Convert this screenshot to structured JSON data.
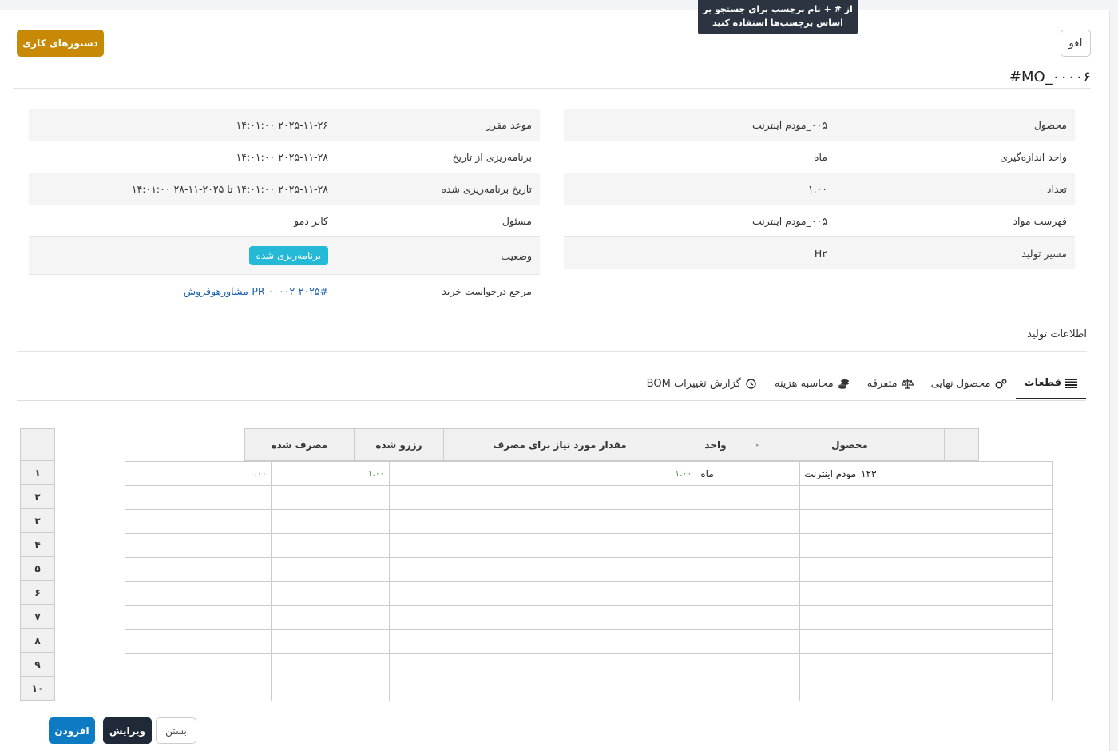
{
  "tooltip": {
    "line1": "از # + نام برچسب برای جستجو بر",
    "line2": "اساس برچسب‌ها استفاده کنید"
  },
  "header": {
    "orders_btn": "دستورهای کاری",
    "cancel_btn": "لغو",
    "mo_title": "#MO_۰۰۰۰۶"
  },
  "left_info": {
    "rows": [
      {
        "label": "موعد مقرر",
        "value": "۲۰۲۵-۱۱-۲۶ ۱۴:۰۱:۰۰"
      },
      {
        "label": "برنامه‌ریزی از تاریخ",
        "value": "۲۰۲۵-۱۱-۲۸ ۱۴:۰۱:۰۰"
      },
      {
        "label": "تاریخ برنامه‌ریزی شده",
        "value": "۲۰۲۵-۱۱-۲۸ ۱۴:۰۱:۰۰ تا ۲۰۲۵-۱۱-۲۸ ۱۴:۰۱:۰۰"
      },
      {
        "label": "مسئول",
        "value": "کابر دمو"
      },
      {
        "label": "وضعیت",
        "value": "برنامه‌ریزی شده"
      },
      {
        "label": "مرجع درخواست خرید",
        "value": "#PR-۰۰۰۰۲-۲۰۲۵-مشاورهوفروش"
      }
    ]
  },
  "right_info": {
    "rows": [
      {
        "label": "محصول",
        "value": "۰۰۵_مودم اینترنت"
      },
      {
        "label": "واحد اندازه‌گیری",
        "value": "ماه"
      },
      {
        "label": "تعداد",
        "value": "۱.۰۰"
      },
      {
        "label": "فهرست مواد",
        "value": "۰۰۵_مودم اینترنت"
      },
      {
        "label": "مسیر تولید",
        "value": "H۲"
      }
    ]
  },
  "section_title": "اطلاعات تولید",
  "tabs": [
    {
      "label": "قطعات",
      "icon": "list-icon"
    },
    {
      "label": "محصول نهایی",
      "icon": "gears-icon"
    },
    {
      "label": "متفرقه",
      "icon": "scale-icon"
    },
    {
      "label": "محاسبه هزینه",
      "icon": "coins-icon"
    },
    {
      "label": "گزارش تغییرات BOM",
      "icon": "clock-icon"
    }
  ],
  "grid": {
    "headers": {
      "product": "محصول",
      "unit": "واحد",
      "required": "مقدار مورد نیاز برای مصرف",
      "reserved": "رزرو شده",
      "consumed": "مصرف شده"
    },
    "row_numbers": [
      "۱",
      "۲",
      "۳",
      "۴",
      "۵",
      "۶",
      "۷",
      "۸",
      "۹",
      "۱۰"
    ],
    "first_row": {
      "product": "۱۲۳_مودم اینترنت",
      "unit": "ماه",
      "required": "۱.۰۰",
      "reserved": "۱.۰۰",
      "consumed": "۰.۰۰"
    }
  },
  "footer": {
    "add_btn": "افزودن",
    "edit_btn": "ویرایش",
    "close_btn": "بستن"
  }
}
